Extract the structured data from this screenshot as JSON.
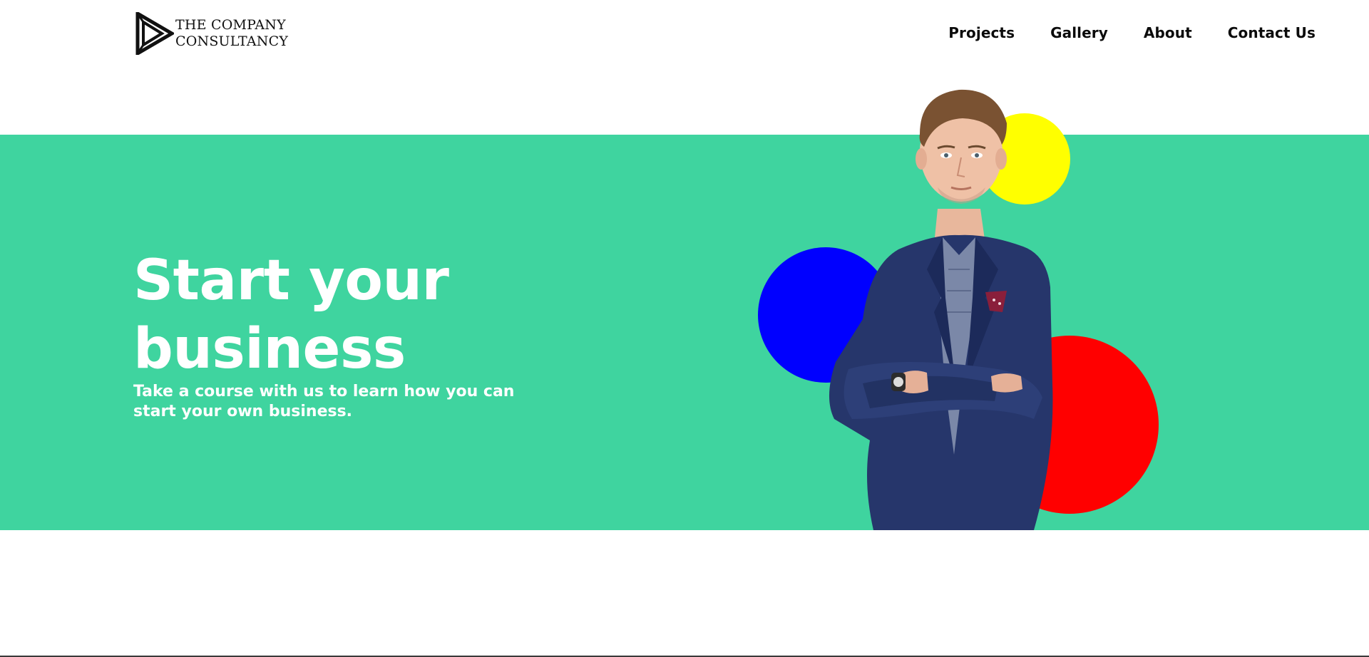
{
  "brand": {
    "line1": "THE COMPANY",
    "line2": "CONSULTANCY",
    "logo_icon": "triangle-play-logo-icon"
  },
  "nav": {
    "items": [
      {
        "label": "Projects"
      },
      {
        "label": "Gallery"
      },
      {
        "label": "About"
      },
      {
        "label": "Contact Us"
      }
    ]
  },
  "hero": {
    "title": "Start your business",
    "subtitle": "Take a course with us to learn how you can start your own business.",
    "image_subject": "businessman-in-navy-suit-photo"
  },
  "colors": {
    "hero_background": "#3fd49f",
    "circle_yellow": "#ffff00",
    "circle_blue": "#0000ff",
    "circle_red": "#ff0000",
    "text_dark": "#0b0b0b",
    "text_light": "#ffffff"
  }
}
